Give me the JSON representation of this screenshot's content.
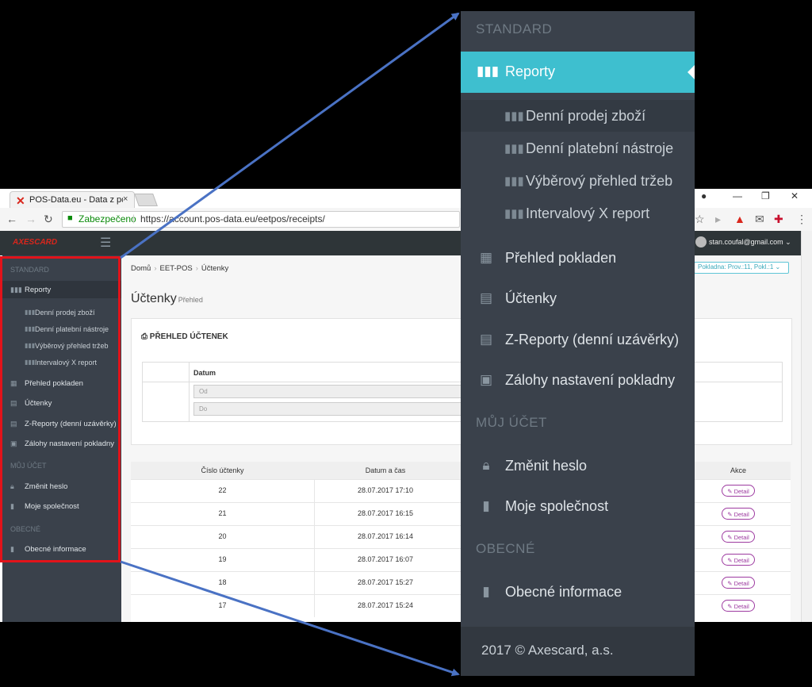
{
  "browser": {
    "tab_title": "POS-Data.eu - Data z pokl",
    "tab_close": "×",
    "secure_label": "Zabezpečeno",
    "url": "https://account.pos-data.eu/eetpos/receipts/"
  },
  "app": {
    "brand": "AXESCARD",
    "user_email": "stan.coufal@gmail.com ⌄",
    "breadcrumb": [
      "Domů",
      "EET-POS",
      "Účtenky"
    ],
    "page_title": "Účtenky",
    "page_subtitle": "Přehled",
    "kasa_select": "Pokladna: Prov.:11, Pokl.:1 ⌄",
    "panel_title": "PŘEHLED ÚČTENEK",
    "filter": {
      "header": "Datum",
      "from_placeholder": "Od",
      "to_placeholder": "Do"
    },
    "table": {
      "columns": [
        "Číslo účtenky",
        "Datum a čas",
        "Akce"
      ],
      "detail_label": "Detail",
      "rows": [
        {
          "number": "22",
          "datetime": "28.07.2017 17:10"
        },
        {
          "number": "21",
          "datetime": "28.07.2017 16:15"
        },
        {
          "number": "20",
          "datetime": "28.07.2017 16:14"
        },
        {
          "number": "19",
          "datetime": "28.07.2017 16:07"
        },
        {
          "number": "18",
          "datetime": "28.07.2017 15:27"
        },
        {
          "number": "17",
          "datetime": "28.07.2017 15:24"
        }
      ]
    }
  },
  "sidebar": {
    "sections": {
      "standard": "STANDARD",
      "muj_ucet": "MŮJ ÚČET",
      "obecne": "OBECNÉ"
    },
    "items": {
      "reporty": "Reporty",
      "denni_prodej": "Denní prodej zboží",
      "denni_platebni": "Denní platební nástroje",
      "vyberovy": "Výběrový přehled tržeb",
      "intervalovy": "Intervalový X report",
      "prehled_pokladen": "Přehled pokladen",
      "uctenky": "Účtenky",
      "z_reporty": "Z-Reporty (denní uzávěrky)",
      "zalohy": "Zálohy nastavení pokladny",
      "zmenit_heslo": "Změnit heslo",
      "moje_spolecnost": "Moje společnost",
      "obecne_informace": "Obecné informace"
    },
    "footer": "2017 © Axescard, a.s."
  },
  "colors": {
    "sidebar_bg": "#3a414b",
    "active_accent": "#3ebfcf",
    "highlight_border": "#e2131a",
    "arrow": "#4a72c4"
  },
  "icons": {
    "chart": "bar-chart-icon",
    "calculator": "calculator-icon",
    "book": "book-icon",
    "floppy": "floppy-disk-icon",
    "lock": "lock-icon",
    "building": "building-icon"
  }
}
